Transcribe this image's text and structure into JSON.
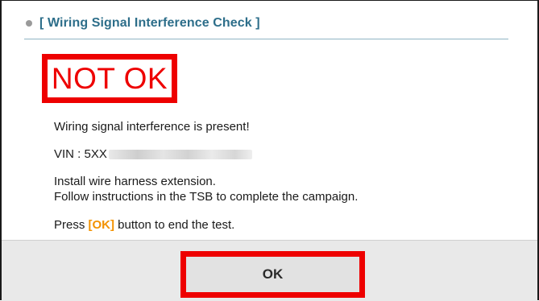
{
  "header": {
    "title": "[ Wiring Signal Interference Check ]"
  },
  "result": {
    "status": "NOT OK",
    "status_color": "#ee0000"
  },
  "messages": {
    "line1": "Wiring signal interference is present!",
    "vin_label": "VIN : 5XX",
    "instruction1": "Install wire harness extension.",
    "instruction2": "Follow instructions in the TSB to complete the campaign.",
    "press_prefix": "Press ",
    "press_ok": "[OK]",
    "press_suffix": " button to end the test."
  },
  "footer": {
    "ok_button": "OK"
  },
  "colors": {
    "accent": "#2d6e8a",
    "ok_highlight": "#f39200",
    "callout": "#ee0000"
  }
}
